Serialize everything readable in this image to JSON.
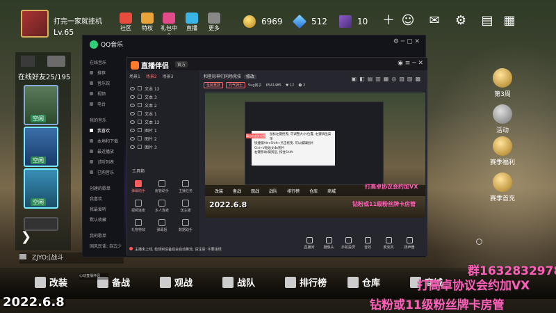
{
  "hud": {
    "player_name": "打完一家就挂机",
    "player_level": "Lv.65",
    "buttons": [
      "社区",
      "特权",
      "礼包中心",
      "直播",
      "更多"
    ],
    "gold": "6969",
    "diamond": "512",
    "ticket": "10"
  },
  "left_panel": {
    "online_count": "在线好友25/195",
    "friend_tag": "空闲"
  },
  "right_side": {
    "season": "第3周",
    "activity": "活动",
    "reward": "赛季福利",
    "first": "赛季首充"
  },
  "chat": {
    "line": "ZJYO:[战斗"
  },
  "bottom_bar": [
    {
      "label": "改装"
    },
    {
      "label": "备战"
    },
    {
      "label": "观战"
    },
    {
      "label": "战队"
    },
    {
      "label": "排行榜"
    },
    {
      "label": "仓库"
    },
    {
      "label": "商城"
    }
  ],
  "overlays": {
    "date": "2022.6.8",
    "qq_group": "群1632832978",
    "tip_line1": "打高卓协议会约加VX",
    "tip_line2": "钻粉或11级粉丝牌卡房管"
  },
  "qq_music": {
    "title": "QQ音乐",
    "side_items": [
      "在线音乐",
      "推荐",
      "音乐馆",
      "视频",
      "电台",
      "我的音乐",
      "我喜欢",
      "本地和下载",
      "最近播放",
      "试听列表",
      "已购音乐",
      "创建的歌单",
      "我喜欢",
      "我最爱听",
      "默认收藏",
      "我的歌单",
      "国风民谣: 自古少"
    ]
  },
  "live_app": {
    "logo": "直播伴侣",
    "version": "官方",
    "scene_tabs": [
      "场景1",
      "场景2",
      "场景3"
    ],
    "sources": [
      "文本 12",
      "文本 3",
      "文本 2",
      "文本 1",
      "文本 12",
      "图片 1",
      "图片 2",
      "图片 3"
    ],
    "tools_label": "工具箱",
    "tools": [
      "弹幕助手",
      "房管助手",
      "主播任务",
      "视频连麦",
      "多人连麦",
      "送主播",
      "礼物特效",
      "弹幕姬",
      "数据助手"
    ],
    "room_title": "和星际神们同场竞技",
    "room_title_edit": "修改",
    "room_meta": [
      "全民竞技",
      "元气骑士",
      "5ug房子",
      "6541485"
    ],
    "likes": "12",
    "fans": "2",
    "tooltip": [
      "鼠标左键拖曳, 可调整大小/位置, 右键调出菜单",
      "快捷键Alt+Shift+点击拖曳, 可以编辑图片",
      "Ctrl+V粘贴文本/图片",
      "右键移动/裁剪层, 按住Shift"
    ],
    "tooltip_hl": "请点击此处设置",
    "preview_bar": [
      "改装",
      "备战",
      "观战",
      "战队",
      "排行榜",
      "仓库",
      "商城"
    ],
    "preview_date": "2022.6.8",
    "preview_ovl1": "打高卓协议会约加VX",
    "preview_ovl2": "钻粉或11级粉丝牌卡房管",
    "controls": [
      "直播间",
      "摄像头",
      "手机投屏",
      "音效",
      "麦克风",
      "扬声器"
    ],
    "status": "主播未上线, 检测到设备后会自动推流, 请注意: 不要违规"
  },
  "taskbar": {
    "chip": "心动直播伴侣"
  }
}
